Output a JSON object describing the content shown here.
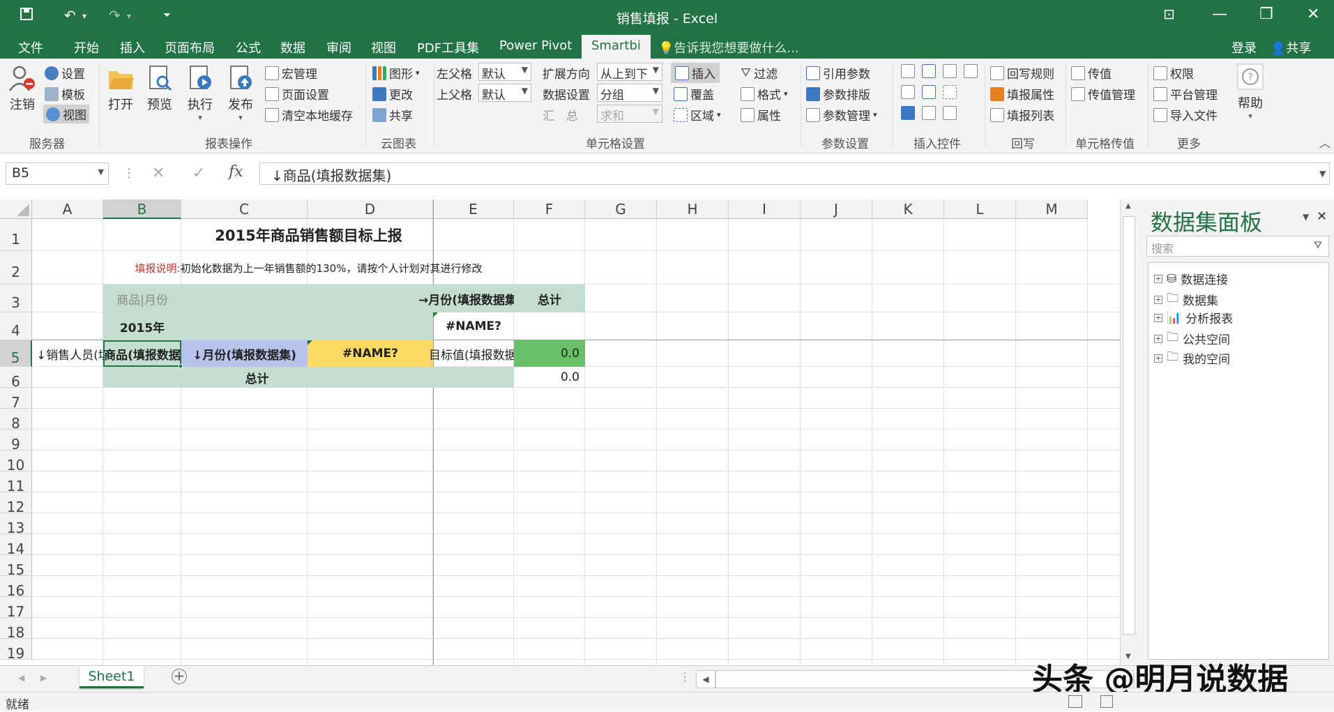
{
  "window": {
    "title": "销售填报 - Excel"
  },
  "menu": {
    "tabs": [
      "文件",
      "开始",
      "插入",
      "页面布局",
      "公式",
      "数据",
      "审阅",
      "视图",
      "PDF工具集",
      "Power Pivot",
      "Smartbi"
    ],
    "tell_me": "告诉我您想要做什么...",
    "login": "登录",
    "share": "共享"
  },
  "ribbon": {
    "server": {
      "logout": "注销",
      "settings": "设置",
      "template": "模板",
      "view": "视图",
      "group": "服务器"
    },
    "report_ops": {
      "open": "打开",
      "preview": "预览",
      "execute": "执行",
      "publish": "发布",
      "macro": "宏管理",
      "page_setup": "页面设置",
      "clear_cache": "清空本地缓存",
      "group": "报表操作"
    },
    "cloud_chart": {
      "chart": "图形",
      "change": "更改",
      "share": "共享",
      "group": "云图表"
    },
    "cell_settings": {
      "left_parent": "左父格",
      "left_parent_value": "默认",
      "top_parent": "上父格",
      "top_parent_value": "默认",
      "summary": "汇　总",
      "summary_value": "求和",
      "expand_dir": "扩展方向",
      "expand_dir_value": "从上到下",
      "data_setting": "数据设置",
      "data_setting_value": "分组",
      "insert": "插入",
      "cover": "覆盖",
      "region": "区域",
      "filter": "过滤",
      "format": "格式",
      "property": "属性",
      "group": "单元格设置"
    },
    "param_settings": {
      "ref_param": "引用参数",
      "param_layout": "参数排版",
      "param_manage": "参数管理",
      "group": "参数设置"
    },
    "insert_controls": {
      "group": "插入控件"
    },
    "writeback": {
      "rule": "回写规则",
      "fill_prop": "填报属性",
      "fill_list": "填报列表",
      "group": "回写"
    },
    "cell_pass": {
      "pass": "传值",
      "pass_manage": "传值管理",
      "group": "单元格传值"
    },
    "more": {
      "permission": "权限",
      "platform": "平台管理",
      "import": "导入文件",
      "help": "帮助",
      "group": "更多"
    }
  },
  "formula_bar": {
    "name_box": "B5",
    "cancel": "✕",
    "confirm": "✓",
    "fx": "fx",
    "content": "↓商品(填报数据集)"
  },
  "grid": {
    "columns": [
      "A",
      "B",
      "C",
      "D",
      "E",
      "F",
      "G",
      "H",
      "I",
      "J",
      "K",
      "L",
      "M"
    ],
    "rows": [
      "1",
      "2",
      "3",
      "4",
      "5",
      "6",
      "7",
      "8",
      "9",
      "10",
      "11",
      "12",
      "13",
      "14",
      "15",
      "16",
      "17",
      "18",
      "19"
    ],
    "cells": {
      "title": "2015年商品销售额目标上报",
      "note_label": "填报说明:",
      "note_text": " 初始化数据为上一年销售额的130%，请按个人计划对其进行修改",
      "b3": "商品|月份",
      "e3": "→月份(填报数据集",
      "f3": "总计",
      "b4": "2015年",
      "e4": "#NAME?",
      "a5": "↓销售人员(填",
      "b5": "商品(填报数据",
      "c5": "↓月份(填报数据集)",
      "d5": "#NAME?",
      "e5": "目标值(填报数据",
      "f5": "0.0",
      "total_label": "总计",
      "f6": "0.0"
    }
  },
  "panel": {
    "title": "数据集面板",
    "search_placeholder": "搜索",
    "tree": [
      "数据连接",
      "数据集",
      "分析报表",
      "公共空间",
      "我的空间"
    ]
  },
  "sheets": [
    "Sheet1"
  ],
  "status": {
    "ready": "就绪"
  },
  "watermark": "头条 @明月说数据",
  "colors": {
    "excel_green": "#217346",
    "header_green": "#c4ddd1",
    "blue_cell": "#b7c3ea",
    "yellow_cell": "#ffd966",
    "green_cell": "#6abf69"
  }
}
